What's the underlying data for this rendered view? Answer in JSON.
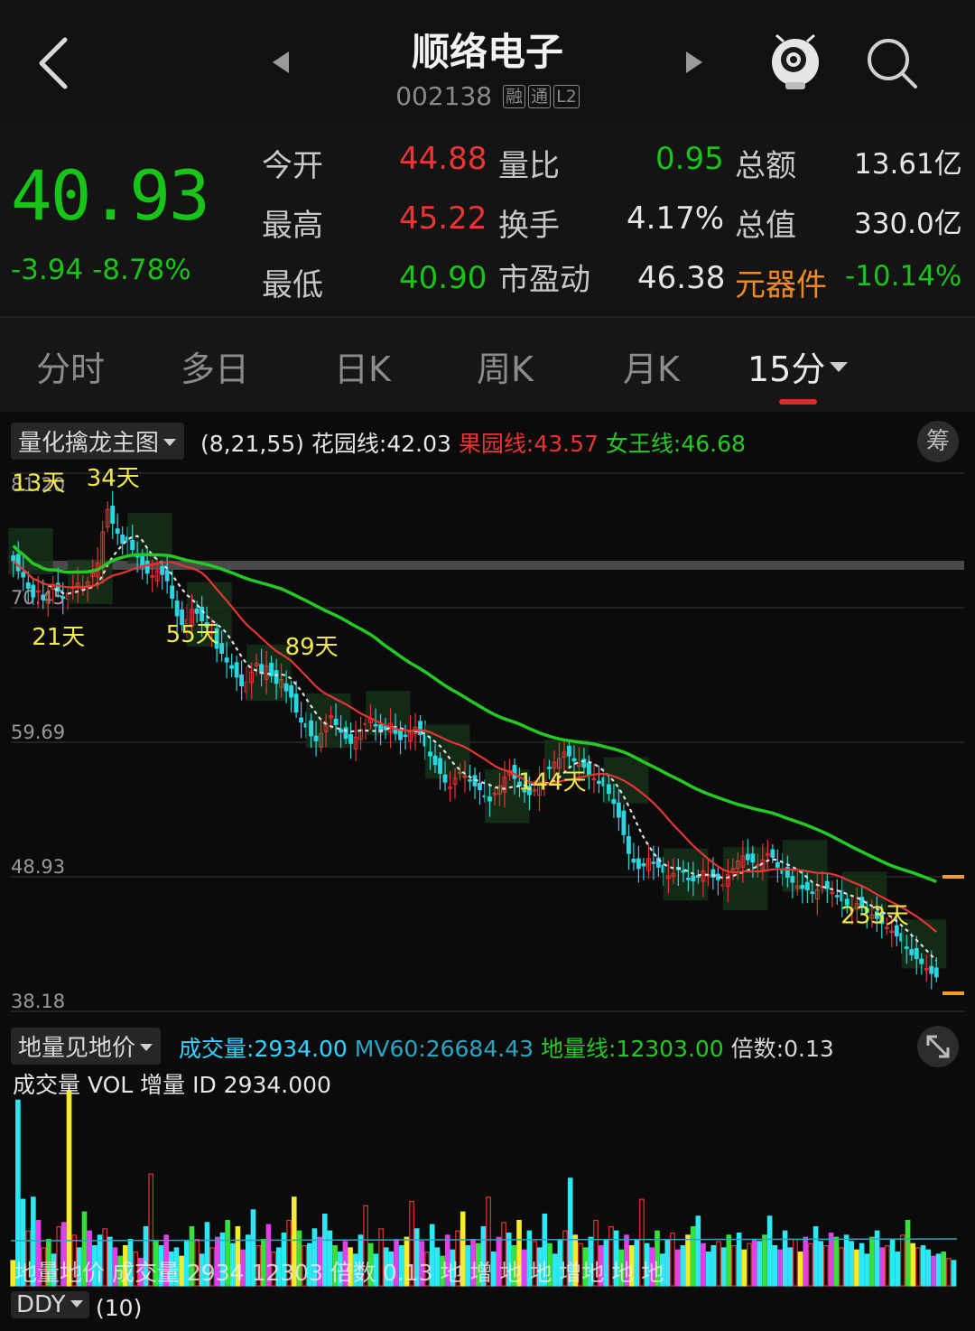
{
  "header": {
    "title": "顺络电子",
    "code": "002138",
    "tags": [
      "融",
      "通",
      "L2"
    ]
  },
  "quote": {
    "price": "40.93",
    "change": "-3.94",
    "change_pct": "-8.78%",
    "fields": [
      {
        "label": "今开",
        "value": "44.88"
      },
      {
        "label": "最高",
        "value": "45.22"
      },
      {
        "label": "最低",
        "value": "40.90"
      },
      {
        "label": "量比",
        "value": "0.95"
      },
      {
        "label": "换手",
        "value": "4.17%"
      },
      {
        "label": "市盈动",
        "value": "46.38"
      },
      {
        "label": "总额",
        "value": "13.61亿"
      },
      {
        "label": "总值",
        "value": "330.0亿"
      },
      {
        "label": "元器件",
        "value": "-10.14%"
      }
    ]
  },
  "tabs": [
    "分时",
    "多日",
    "日K",
    "周K",
    "月K",
    "15分"
  ],
  "main_indicator": {
    "dropdown": "量化擒龙主图",
    "params": "(8,21,55)",
    "lines": [
      {
        "name": "花园线",
        "value": "42.03",
        "color": "#e0e0e0"
      },
      {
        "name": "果园线",
        "value": "43.57",
        "color": "#e83434"
      },
      {
        "name": "女王线",
        "value": "46.68",
        "color": "#24c924"
      }
    ],
    "badge": "筹"
  },
  "chart_data": {
    "type": "candlestick",
    "y_ticks": [
      "81.20",
      "70.45",
      "59.69",
      "48.93",
      "38.18"
    ],
    "ylim": [
      38.18,
      81.2
    ],
    "labels": [
      {
        "text": "13天",
        "index": 3,
        "price": 79.8
      },
      {
        "text": "34天",
        "index": 18,
        "price": 80.2
      },
      {
        "text": "21天",
        "index": 7,
        "price": 67.5
      },
      {
        "text": "55天",
        "index": 34,
        "price": 67.7
      },
      {
        "text": "89天",
        "index": 58,
        "price": 66.7
      },
      {
        "text": "144天",
        "index": 105,
        "price": 55.9
      },
      {
        "text": "233天",
        "index": 170,
        "price": 45.2
      }
    ],
    "series": [
      {
        "name": "花园线",
        "color": "#e0e0e0",
        "style": "dashed"
      },
      {
        "name": "果园线",
        "color": "#e83434",
        "style": "solid"
      },
      {
        "name": "女王线",
        "color": "#24c924",
        "style": "solid"
      }
    ],
    "closes": [
      74.2,
      73.4,
      72.9,
      72.0,
      71.3,
      71.8,
      71.1,
      71.5,
      72.2,
      71.8,
      71.2,
      71.6,
      72.1,
      72.4,
      72.0,
      72.5,
      73.2,
      74.0,
      76.5,
      78.3,
      77.2,
      76.4,
      75.6,
      75.8,
      75.1,
      74.5,
      73.7,
      73.2,
      73.0,
      73.4,
      73.1,
      72.6,
      71.2,
      69.8,
      69.1,
      69.5,
      70.3,
      70.0,
      69.4,
      68.9,
      68.5,
      67.2,
      66.8,
      66.1,
      65.6,
      64.9,
      64.2,
      64.5,
      65.3,
      66.0,
      65.2,
      65.8,
      65.0,
      64.4,
      64.7,
      63.8,
      63.3,
      62.1,
      61.3,
      60.9,
      60.2,
      59.8,
      60.4,
      61.2,
      61.8,
      61.1,
      60.5,
      60.0,
      59.6,
      60.1,
      60.7,
      61.2,
      61.6,
      61.0,
      60.5,
      60.7,
      61.2,
      60.4,
      59.9,
      60.2,
      60.6,
      60.9,
      60.3,
      59.4,
      58.6,
      57.9,
      57.2,
      56.5,
      56.1,
      56.8,
      57.3,
      57.0,
      56.6,
      56.2,
      55.9,
      55.4,
      55.0,
      55.6,
      56.2,
      56.9,
      57.4,
      56.8,
      56.2,
      55.8,
      55.5,
      55.9,
      56.5,
      57.2,
      57.6,
      58.1,
      58.4,
      58.9,
      58.6,
      58.2,
      58.0,
      57.7,
      57.1,
      56.8,
      56.4,
      56.2,
      55.6,
      54.8,
      53.7,
      52.3,
      50.8,
      50.1,
      49.6,
      49.8,
      50.4,
      50.0,
      49.7,
      49.3,
      49.0,
      49.2,
      49.5,
      49.3,
      48.8,
      48.6,
      48.9,
      49.4,
      49.1,
      48.9,
      48.7,
      48.3,
      49.1,
      49.6,
      50.2,
      50.6,
      50.3,
      50.1,
      49.9,
      50.3,
      50.8,
      50.5,
      49.7,
      49.2,
      48.9,
      48.5,
      48.2,
      48.0,
      47.9,
      47.6,
      47.9,
      48.2,
      48.0,
      47.7,
      47.4,
      47.0,
      46.7,
      46.4,
      46.8,
      46.5,
      46.1,
      45.9,
      45.6,
      45.2,
      44.9,
      44.6,
      44.2,
      43.8,
      43.2,
      42.7,
      42.4,
      42.0,
      41.6,
      41.2,
      40.93
    ]
  },
  "volume_indicator": {
    "dropdown": "地量见地价",
    "items": [
      {
        "name": "成交量",
        "value": "2934.00",
        "color": "#30d6ff"
      },
      {
        "name": "MV60",
        "value": "26684.43",
        "color": "#2aa6c4"
      },
      {
        "name": "地量线",
        "value": "12303.00",
        "color": "#24c924"
      },
      {
        "name": "倍数",
        "value": "0.13",
        "color": "#d8d8d8"
      }
    ],
    "overlay_text": "成交量 VOL  增量 ID  2934.000",
    "bottom_text": "地量地价 成交量 2934 12303 倍数 0.13 地 增 地 地 增地 地 地",
    "chart_data": {
      "type": "bar",
      "values": [
        120,
        880,
        410,
        260,
        420,
        310,
        180,
        220,
        150,
        280,
        300,
        920,
        240,
        180,
        350,
        260,
        190,
        240,
        270,
        230,
        180,
        140,
        190,
        220,
        160,
        130,
        280,
        530,
        210,
        190,
        240,
        160,
        180,
        140,
        210,
        280,
        220,
        150,
        300,
        180,
        230,
        250,
        310,
        200,
        280,
        170,
        240,
        360,
        190,
        220,
        290,
        160,
        180,
        250,
        310,
        420,
        260,
        190,
        200,
        270,
        230,
        340,
        260,
        190,
        160,
        210,
        180,
        150,
        240,
        380,
        200,
        150,
        270,
        180,
        160,
        220,
        190,
        230,
        400,
        270,
        210,
        160,
        290,
        180,
        140,
        240,
        170,
        260,
        350,
        190,
        220,
        200,
        280,
        420,
        160,
        230,
        300,
        250,
        190,
        310,
        170,
        260,
        210,
        180,
        340,
        200,
        150,
        220,
        260,
        510,
        240,
        200,
        180,
        230,
        310,
        190,
        220,
        280,
        260,
        170,
        240,
        190,
        220,
        410,
        200,
        180,
        260,
        150,
        220,
        250,
        170,
        190,
        240,
        280,
        330,
        200,
        160,
        190,
        210,
        180,
        240,
        190,
        250,
        170,
        200,
        220,
        210,
        240,
        330,
        190,
        170,
        260,
        180,
        220,
        160,
        230,
        200,
        280,
        210,
        190,
        250,
        230,
        180,
        240,
        210,
        170,
        200,
        150,
        230,
        260,
        180,
        190,
        220,
        160,
        240,
        310,
        200,
        180,
        190,
        170,
        140,
        150,
        160,
        130,
        120
      ],
      "colors": [
        "cyan",
        "red",
        "yellow",
        "green",
        "magenta"
      ]
    }
  },
  "ddy": {
    "dropdown": "DDY",
    "params": "(10)"
  }
}
